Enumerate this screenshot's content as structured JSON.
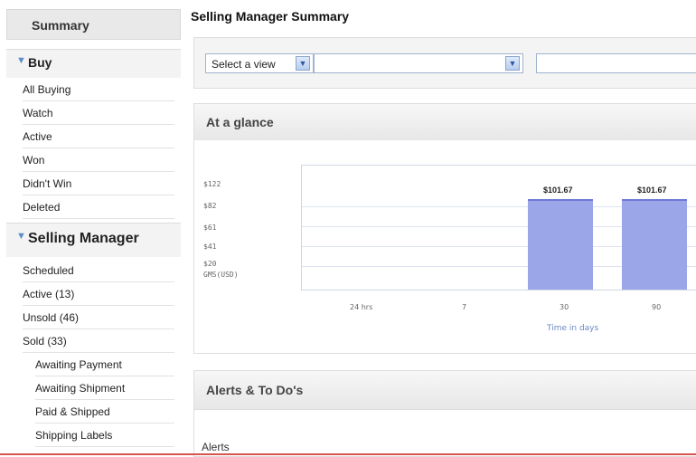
{
  "sidebar": {
    "summary_label": "Summary",
    "buy": {
      "title": "Buy",
      "items": [
        "All Buying",
        "Watch",
        "Active",
        "Won",
        "Didn't Win",
        "Deleted"
      ]
    },
    "selling_manager": {
      "title": "Selling Manager",
      "items": [
        "Scheduled",
        "Active (13)",
        "Unsold (46)",
        "Sold (33)"
      ],
      "sub_items": [
        "Awaiting Payment",
        "Awaiting Shipment",
        "Paid & Shipped",
        "Shipping Labels"
      ]
    }
  },
  "page": {
    "title": "Selling Manager Summary"
  },
  "view_bar": {
    "select_view": "Select a view",
    "second_select": "",
    "third_input": ""
  },
  "at_a_glance": {
    "title": "At a glance",
    "chart_data": {
      "type": "bar",
      "categories": [
        "24 hrs",
        "7",
        "30",
        "90"
      ],
      "values": [
        0,
        0,
        101.67,
        101.67
      ],
      "value_labels": [
        "",
        "",
        "$101.67",
        "$101.67"
      ],
      "yticks": [
        "$122",
        "$82",
        "$61",
        "$41",
        "$20"
      ],
      "ylabel": "GMS(USD)",
      "xlabel": "Time in days",
      "ylim": [
        0,
        122
      ],
      "grid": true,
      "bar_color": "#9aa6e8"
    }
  },
  "alerts": {
    "title": "Alerts & To Do's",
    "alerts_label": "Alerts"
  },
  "colors": {
    "accent_triangle": "#5b8ec9",
    "bottom_line": "#d9534f"
  }
}
